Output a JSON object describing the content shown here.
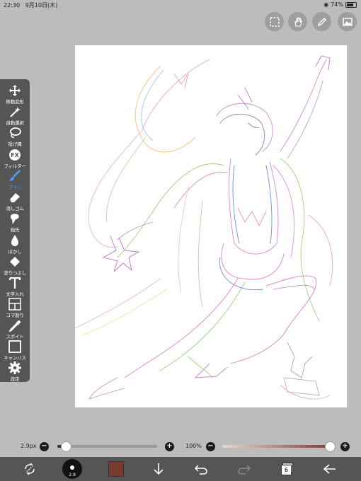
{
  "status": {
    "time": "22:30",
    "date": "9月10日(木)",
    "battery": "74%",
    "battery_level": 0.74
  },
  "top_buttons": [
    {
      "name": "selection-icon"
    },
    {
      "name": "hand-tool-icon"
    },
    {
      "name": "pen-icon"
    },
    {
      "name": "layer-image-icon"
    }
  ],
  "tools": [
    {
      "label": "移動変形",
      "icon": "move-icon",
      "active": false
    },
    {
      "label": "自動選択",
      "icon": "magic-wand-icon",
      "active": false
    },
    {
      "label": "投げ縄",
      "icon": "lasso-icon",
      "active": false
    },
    {
      "label": "フィルター",
      "icon": "fx-icon",
      "active": false
    },
    {
      "label": "ブラシ",
      "icon": "brush-icon",
      "active": true
    },
    {
      "label": "消しゴム",
      "icon": "eraser-icon",
      "active": false
    },
    {
      "label": "指先",
      "icon": "finger-icon",
      "active": false
    },
    {
      "label": "ぼかし",
      "icon": "blur-drop-icon",
      "active": false
    },
    {
      "label": "塗りつぶし",
      "icon": "fill-bucket-icon",
      "active": false
    },
    {
      "label": "文字入れ",
      "icon": "text-icon",
      "active": false
    },
    {
      "label": "コマ割り",
      "icon": "panel-icon",
      "active": false
    },
    {
      "label": "スポイト",
      "icon": "eyedropper-icon",
      "active": false
    },
    {
      "label": "キャンバス",
      "icon": "canvas-icon",
      "active": false
    },
    {
      "label": "設定",
      "icon": "gear-icon",
      "active": false
    }
  ],
  "brush": {
    "size_label": "2.9px",
    "size_slider": 0.04,
    "opacity_label": "100%",
    "opacity_slider": 1.0
  },
  "bottom": {
    "brush_preview_label": "2.9",
    "color": "#7a3a30",
    "layer_count": "6"
  }
}
